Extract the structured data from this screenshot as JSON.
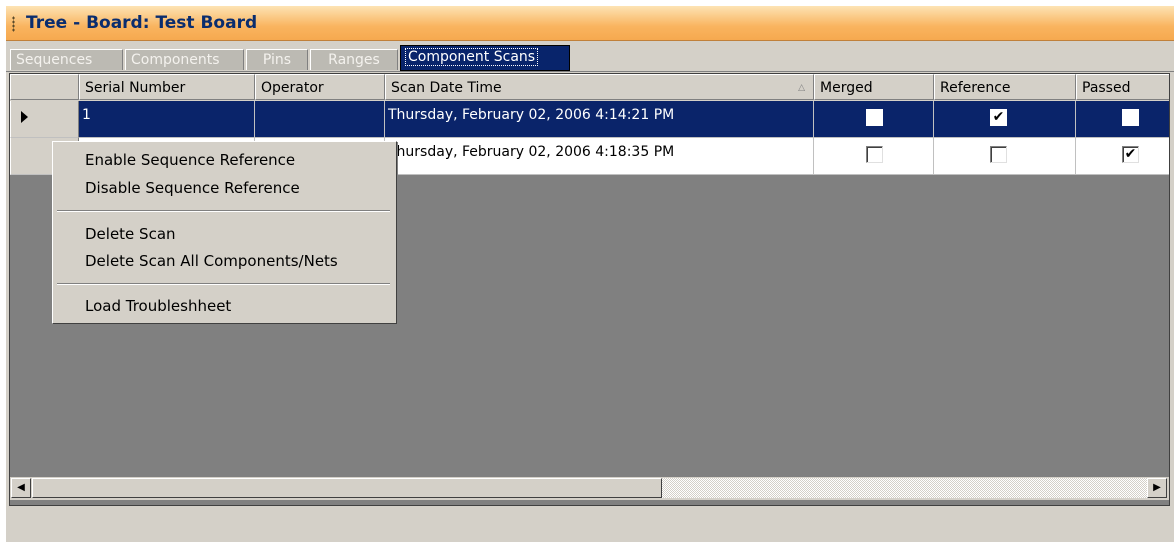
{
  "window": {
    "title": "Tree - Board: Test Board"
  },
  "tabs": [
    "Sequences",
    "Components",
    "Pins",
    "Ranges",
    "Component Scans"
  ],
  "active_tab": "Component Scans",
  "grid": {
    "columns": [
      "Serial Number",
      "Operator",
      "Scan Date Time",
      "Merged",
      "Reference",
      "Passed"
    ],
    "rows": [
      {
        "serial": "1",
        "operator": "",
        "scan_date": "Thursday, February 02, 2006 4:14:21 PM",
        "merged": false,
        "reference": true,
        "passed": false,
        "selected": true
      },
      {
        "serial": "",
        "operator": "",
        "scan_date": "Thursday, February 02, 2006 4:18:35 PM",
        "merged": false,
        "reference": false,
        "passed": true,
        "selected": false
      }
    ]
  },
  "context_menu": {
    "items": [
      "Enable Sequence Reference",
      "Disable Sequence Reference",
      "Delete Scan",
      "Delete Scan All Components/Nets",
      "Load Troubleshheet"
    ]
  },
  "icons": {
    "scroll_left": "arrow-left-icon",
    "scroll_right": "arrow-right-icon",
    "current_row": "row-pointer-icon",
    "sort": "sort-ascending-icon"
  },
  "colors": {
    "title_gradient": "#f9b45f",
    "selection": "#0a246a",
    "active_tab": "#08246b",
    "chrome": "#d4d0c8"
  }
}
